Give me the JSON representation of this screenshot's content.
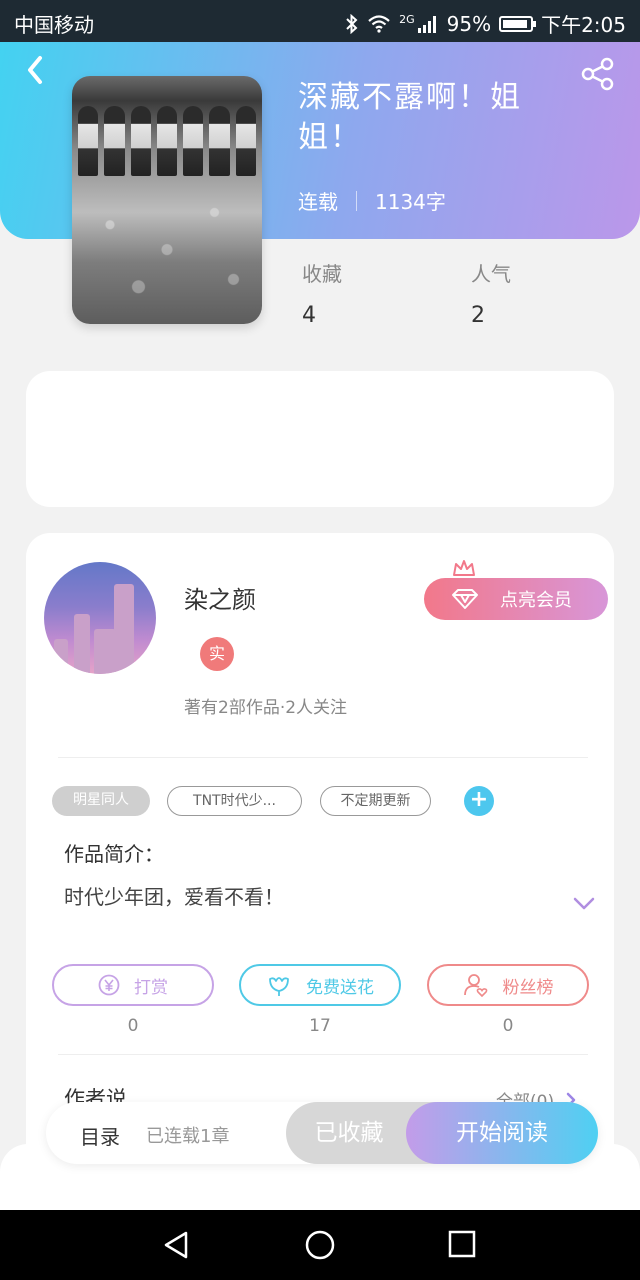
{
  "status_bar": {
    "carrier": "中国移动",
    "network": "2G",
    "battery": "95%",
    "time": "下午2:05"
  },
  "header": {
    "back_icon": "chevron-left-icon",
    "share_icon": "share-icon"
  },
  "book": {
    "title": "深藏不露啊！姐姐！",
    "status": "连载",
    "word_count": "1134字",
    "stats": [
      {
        "label": "收藏",
        "value": "4"
      },
      {
        "label": "人气",
        "value": "2"
      }
    ]
  },
  "author": {
    "name": "染之颜",
    "badge": "实",
    "summary": "著有2部作品·2人关注",
    "vip_button": "点亮会员"
  },
  "tags": [
    "明星同人",
    "TNT时代少...",
    "不定期更新"
  ],
  "intro": {
    "heading": "作品简介：",
    "text": "时代少年团，爱看不看！"
  },
  "actions": [
    {
      "label": "打赏",
      "count": "0",
      "icon": "yen-icon",
      "color": "#c6a3e6"
    },
    {
      "label": "免费送花",
      "count": "17",
      "icon": "flower-icon",
      "color": "#4fc9e6"
    },
    {
      "label": "粉丝榜",
      "count": "0",
      "icon": "fan-user-icon",
      "color": "#ef8a8a"
    }
  ],
  "author_says": {
    "heading": "作者说",
    "all_link": "全部(0)"
  },
  "bottom_bar": {
    "toc": "目录",
    "chapters": "已连载1章",
    "collected": "已收藏",
    "read": "开始阅读"
  },
  "colors": {
    "header_start": "#43d2f1",
    "header_end": "#bb97ea",
    "accent_pink": "#f2788a"
  }
}
